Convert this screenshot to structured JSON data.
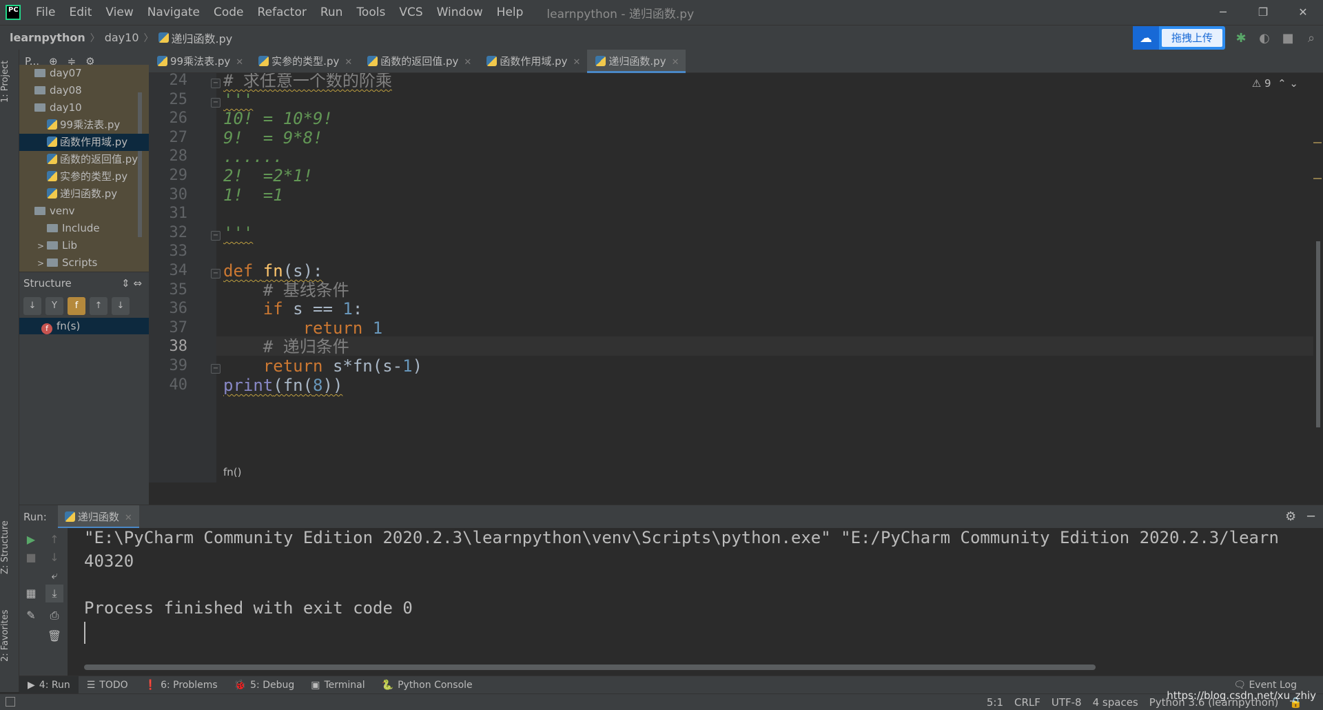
{
  "menu": {
    "items": [
      "File",
      "Edit",
      "View",
      "Navigate",
      "Code",
      "Refactor",
      "Run",
      "Tools",
      "VCS",
      "Window",
      "Help"
    ],
    "window_title": "learnpython - 递归函数.py"
  },
  "navbar": {
    "crumbs": [
      "learnpython",
      "day10",
      "递归函数.py"
    ],
    "upload_label": "拖拽上传"
  },
  "left_stripe": {
    "project_tab": "1: Project",
    "structure_tab": "Z: Structure",
    "favorites_tab": "2: Favorites"
  },
  "project": {
    "selector": "P...",
    "tree": [
      {
        "label": "day07",
        "indent": 0,
        "type": "folder",
        "arrow": ""
      },
      {
        "label": "day08",
        "indent": 0,
        "type": "folder",
        "arrow": ""
      },
      {
        "label": "day10",
        "indent": 0,
        "type": "folder",
        "arrow": ""
      },
      {
        "label": "99乘法表.py",
        "indent": 1,
        "type": "py",
        "arrow": ""
      },
      {
        "label": "函数作用域.py",
        "indent": 1,
        "type": "py",
        "arrow": "",
        "selected": true
      },
      {
        "label": "函数的返回值.py",
        "indent": 1,
        "type": "py",
        "arrow": ""
      },
      {
        "label": "实参的类型.py",
        "indent": 1,
        "type": "py",
        "arrow": ""
      },
      {
        "label": "递归函数.py",
        "indent": 1,
        "type": "py",
        "arrow": ""
      },
      {
        "label": "venv",
        "indent": 0,
        "type": "folder",
        "arrow": ""
      },
      {
        "label": "Include",
        "indent": 1,
        "type": "folder",
        "arrow": ""
      },
      {
        "label": "Lib",
        "indent": 1,
        "type": "folder",
        "arrow": ">"
      },
      {
        "label": "Scripts",
        "indent": 1,
        "type": "folder",
        "arrow": ">"
      }
    ]
  },
  "structure": {
    "title": "Structure",
    "item": "fn(s)",
    "badge": "f"
  },
  "tabs": [
    {
      "label": "99乘法表.py",
      "active": false
    },
    {
      "label": "实参的类型.py",
      "active": false
    },
    {
      "label": "函数的返回值.py",
      "active": false
    },
    {
      "label": "函数作用域.py",
      "active": false
    },
    {
      "label": "递归函数.py",
      "active": true
    }
  ],
  "editor": {
    "warning_count": "9",
    "current_line": 38,
    "breadcrumb": "fn()",
    "lines": [
      {
        "n": 24,
        "html": "<span class=\"cm squig\"># 求任意一个数的阶乘</span>"
      },
      {
        "n": 25,
        "html": "<span class=\"doc squig\">'''</span>"
      },
      {
        "n": 26,
        "html": "<span class=\"doc\">10! = 10*9!</span>"
      },
      {
        "n": 27,
        "html": "<span class=\"doc\">9!  = 9*8!</span>"
      },
      {
        "n": 28,
        "html": "<span class=\"doc\">......</span>"
      },
      {
        "n": 29,
        "html": "<span class=\"doc\">2!  =2*1!</span>"
      },
      {
        "n": 30,
        "html": "<span class=\"doc\">1!  =1</span>"
      },
      {
        "n": 31,
        "html": ""
      },
      {
        "n": 32,
        "html": "<span class=\"doc squig\">'''</span>"
      },
      {
        "n": 33,
        "html": ""
      },
      {
        "n": 34,
        "html": "<span class=\"squig\"><span class=\"kw\">def </span><span class=\"fn\">fn</span><span class=\"plain\">(s):</span></span>"
      },
      {
        "n": 35,
        "html": "<span class=\"cm\">    # 基线条件</span>"
      },
      {
        "n": 36,
        "html": "<span class=\"kw\">    if </span><span class=\"plain\">s == </span><span class=\"num\">1</span><span class=\"plain\">:</span>"
      },
      {
        "n": 37,
        "html": "<span class=\"kw\">        return </span><span class=\"num\">1</span>"
      },
      {
        "n": 38,
        "html": "<span class=\"cm\">    # 递归条件</span>"
      },
      {
        "n": 39,
        "html": "<span class=\"kw\">    return </span><span class=\"plain\">s*fn(s-</span><span class=\"num\">1</span><span class=\"plain\">)</span>"
      },
      {
        "n": 40,
        "html": "<span class=\"squig\"><span class=\"bi\">print</span><span class=\"plain\">(fn(</span><span class=\"num\">8</span><span class=\"plain\">))</span></span>"
      }
    ]
  },
  "run": {
    "label": "Run:",
    "tab": "递归函数",
    "console": [
      "\"E:\\PyCharm Community Edition 2020.2.3\\learnpython\\venv\\Scripts\\python.exe\" \"E:/PyCharm Community Edition 2020.2.3/learn",
      "40320",
      "",
      "Process finished with exit code 0"
    ]
  },
  "bottom_tools": [
    {
      "label": "4: Run",
      "active": true,
      "icon": "▶"
    },
    {
      "label": "TODO",
      "active": false,
      "icon": "☰"
    },
    {
      "label": "6: Problems",
      "active": false,
      "icon": "❗"
    },
    {
      "label": "5: Debug",
      "active": false,
      "icon": "🐞"
    },
    {
      "label": "Terminal",
      "active": false,
      "icon": "▣"
    },
    {
      "label": "Python Console",
      "active": false,
      "icon": "🐍"
    }
  ],
  "event_log": "Event Log",
  "status": {
    "position": "5:1",
    "line_sep": "CRLF",
    "encoding": "UTF-8",
    "indent": "4 spaces",
    "interpreter": "Python 3.6 (learnpython)",
    "watermark": "https://blog.csdn.net/xu_zhiy"
  }
}
